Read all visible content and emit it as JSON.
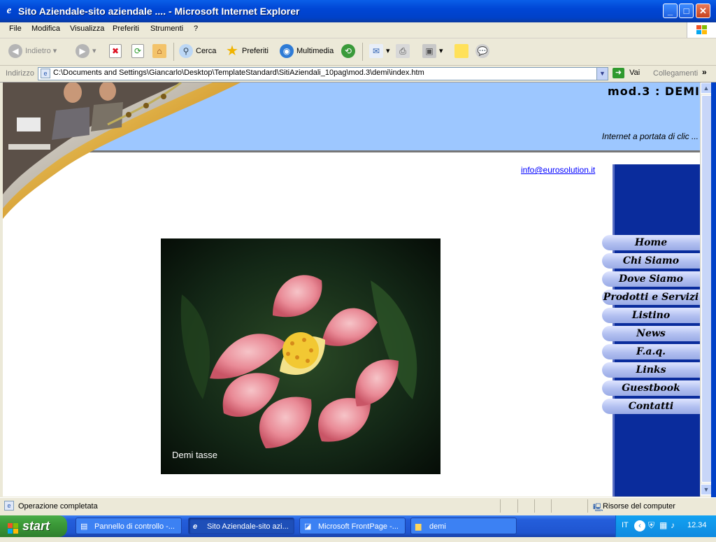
{
  "window": {
    "title": "Sito Aziendale-sito aziendale .... - Microsoft Internet Explorer"
  },
  "menu": [
    "File",
    "Modifica",
    "Visualizza",
    "Preferiti",
    "Strumenti",
    "?"
  ],
  "toolbar": {
    "back": "Indietro",
    "search": "Cerca",
    "favorites": "Preferiti",
    "media": "Multimedia"
  },
  "address": {
    "label": "Indirizzo",
    "url": "C:\\Documents and Settings\\Giancarlo\\Desktop\\TemplateStandard\\SitiAziendali_10pag\\mod.3\\demi\\index.htm",
    "go": "Vai",
    "links": "Collegamenti"
  },
  "site": {
    "title": "mod.3   :   DEMI",
    "tagline": "Internet a portata di clic ...",
    "email": "info@eurosolution.it",
    "nav": [
      "Home",
      "Chi Siamo",
      "Dove Siamo",
      "Prodotti e Servizi",
      "Listino",
      "News",
      "F.a.q.",
      "Links",
      "Guestbook",
      "Contatti"
    ],
    "photo_caption": "Demi tasse"
  },
  "status": {
    "text": "Operazione completata",
    "zone": "Risorse del computer"
  },
  "taskbar": {
    "start": "start",
    "tasks": [
      "Pannello di controllo -...",
      "Sito Aziendale-sito azi...",
      "Microsoft FrontPage -...",
      "demi"
    ],
    "lang": "IT",
    "clock": "12.34"
  },
  "colors": {
    "header": "#9dc7ff",
    "nav_column": "#0a2c9c",
    "title_bar": "#0046d5"
  }
}
